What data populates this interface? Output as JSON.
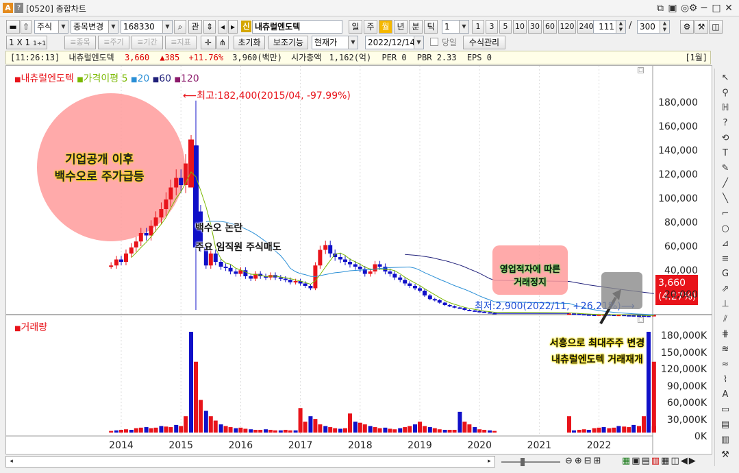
{
  "window": {
    "title": "[0520] 종합차트",
    "logo": "A",
    "help": "?"
  },
  "toolbar": {
    "stock_type": "주식",
    "change_btn": "종목변경",
    "code": "168330",
    "search_lbl": "관",
    "shin": "신",
    "stock_name": "내츄럴엔도텍",
    "periods": [
      "일",
      "주",
      "월",
      "년",
      "분",
      "틱"
    ],
    "active_period": "월",
    "interval": "1",
    "quick": [
      "1",
      "3",
      "5",
      "10",
      "30",
      "60",
      "120",
      "240"
    ],
    "count": "111",
    "slash": "/",
    "total": "300"
  },
  "toolbar2": {
    "layout": "1 X 1",
    "layout_small": "1÷1",
    "dis_buttons": [
      "≡종목",
      "≡주기",
      "≡기간",
      "≡지표"
    ],
    "reset": "초기화",
    "aux": "보조기능",
    "price_mode": "현재가",
    "date": "2022/12/14",
    "today_lbl": "당일",
    "formula": "수식관리"
  },
  "info": {
    "time": "[11:26:13]",
    "name": "내츄럴엔도텍",
    "price": "3,660",
    "change": "▲385",
    "pct": "+11.76%",
    "volume": "3,960(백만)",
    "cap_lbl": "시가총액",
    "cap": "1,162(억)",
    "per": "PER 0",
    "pbr": "PBR 2.33",
    "eps": "EPS 0",
    "month": "[1월]"
  },
  "legend": {
    "name": "내츄럴엔도텍",
    "ma_label": "가격이평",
    "ma": [
      "5",
      "20",
      "60",
      "120"
    ]
  },
  "vol_legend": "거래량",
  "colors": {
    "up": "#e8131a",
    "down": "#1010c8",
    "ma5": "#7ab800",
    "ma20": "#2a8fd6",
    "ma60": "#20207a",
    "annot_pink": "#ff8c8c",
    "price_box": "#e8131a"
  },
  "annotations": {
    "circle_text1": "기업공개 이후",
    "circle_text2": "백수오로 주가급등",
    "mid1": "백수오 논란",
    "mid2": "주요 임직원 주식매도",
    "pink1": "영업적자에 따른",
    "pink2": "거래정지",
    "yellow1": "서흥으로 최대주주 변경",
    "yellow2": "내츄럴엔도텍 거래재개",
    "high": "최고:182,400(2015/04, -97.99%)",
    "low": "최저:2,900(2022/11, +26.21%)",
    "cur_price": "3,660",
    "cur_pct": "(4.27%)"
  },
  "chart_data": {
    "type": "candlestick",
    "x_ticks": [
      "2014",
      "2015",
      "2016",
      "2017",
      "2018",
      "2019",
      "2020",
      "2021",
      "2022"
    ],
    "y_ticks": [
      "180,000",
      "160,000",
      "140,000",
      "120,000",
      "100,000",
      "80,000",
      "60,000",
      "40,000",
      "20,000"
    ],
    "vol_ticks": [
      "180,000K",
      "150,000K",
      "120,000K",
      "90,000K",
      "60,000K",
      "30,000K",
      "0K"
    ],
    "ylim": [
      0,
      195000
    ],
    "vol_ylim": [
      0,
      190000
    ],
    "high": 182400,
    "low": 2900,
    "current": 3660
  },
  "right_tools": [
    "↖",
    "⚲",
    "ℍ",
    "?",
    "⟲",
    "T",
    "✎",
    "╱",
    "╲",
    "⌐",
    "○",
    "⊿",
    "≡",
    "G",
    "⇗",
    "⊥",
    "⫽",
    "⋕",
    "≋",
    "≈",
    "⌇",
    "A",
    "▭",
    "▤",
    "▥",
    "⚒"
  ]
}
